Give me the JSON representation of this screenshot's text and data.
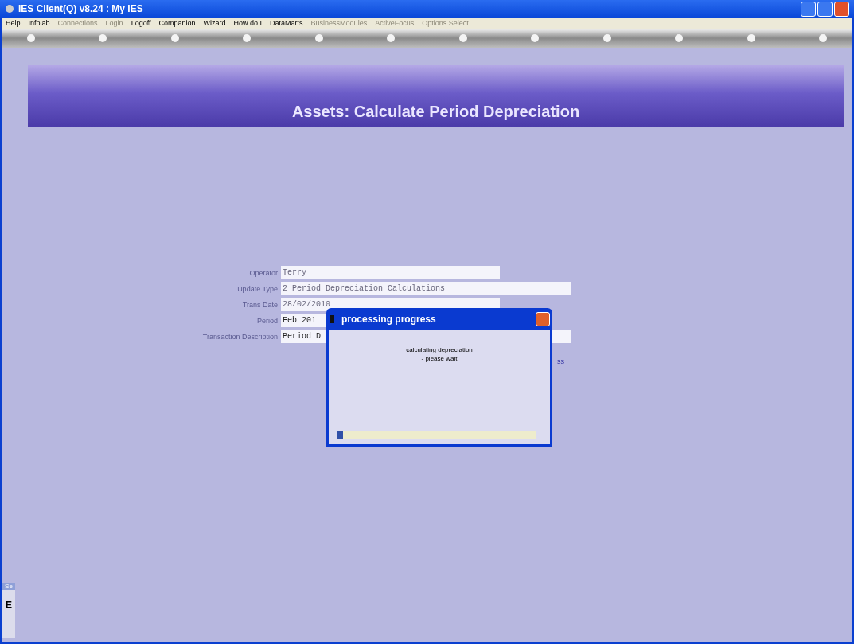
{
  "window": {
    "title": "IES Client(Q) v8.24 : My IES"
  },
  "menu": [
    {
      "label": "Help",
      "disabled": false
    },
    {
      "label": "Infolab",
      "disabled": false
    },
    {
      "label": "Connections",
      "disabled": true
    },
    {
      "label": "Login",
      "disabled": true
    },
    {
      "label": "Logoff",
      "disabled": false
    },
    {
      "label": "Companion",
      "disabled": false
    },
    {
      "label": "Wizard",
      "disabled": false
    },
    {
      "label": "How do I",
      "disabled": false
    },
    {
      "label": "DataMarts",
      "disabled": false
    },
    {
      "label": "BusinessModules",
      "disabled": true
    },
    {
      "label": "ActiveFocus",
      "disabled": true
    },
    {
      "label": "Options Select",
      "disabled": true
    }
  ],
  "header": {
    "title": "Assets: Calculate Period Depreciation"
  },
  "form": [
    {
      "label": "Operator",
      "value": "Terry",
      "wide": false
    },
    {
      "label": "Update Type",
      "value": "2 Period Depreciation Calculations",
      "wide": true
    },
    {
      "label": "Trans Date",
      "value": " 28/02/2010",
      "wide": false
    },
    {
      "label": "Period",
      "value": "Feb 201",
      "wide": false
    },
    {
      "label": "Transaction Description",
      "value": "Period D",
      "wide": true
    }
  ],
  "link": "ss",
  "dialog": {
    "title": "processing progress",
    "message": "calculating depreciation",
    "message_2": "- please wait",
    "level": 0.03
  },
  "side_tab": {
    "label": "Se",
    "key": "E"
  }
}
